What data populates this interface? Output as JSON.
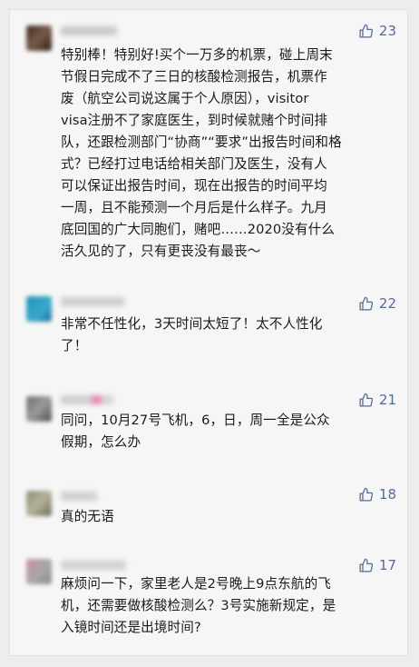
{
  "comments": [
    {
      "likes": "23",
      "text": "特别棒！特别好!买个一万多的机票，碰上周末\n节假日完成不了三日的核酸检测报告，机票作\n废（航空公司说这属于个人原因），visitor\nvisa注册不了家庭医生，到时候就赌个时间排\n队，还跟检测部门“协商”“要求”出报告时间和格\n式？已经打过电话给相关部门及医生，没有人\n可以保证出报告时间，现在出报告的时间平均\n一周，且不能预测一个月后是什么样子。九月\n底回国的广大同胞们，赌吧……2020没有什么\n活久见的了，只有更丧没有最丧～"
    },
    {
      "likes": "22",
      "text": "非常不任性化，3天时间太短了！太不人性化\n了！"
    },
    {
      "likes": "21",
      "text": "同问，10月27号飞机，6，日，周一全是公众\n假期，怎么办"
    },
    {
      "likes": "18",
      "text": "真的无语"
    },
    {
      "likes": "17",
      "text": "麻烦问一下，家里老人是2号晚上9点东航的飞\n机，还需要做核酸检测么？3号实施新规定，是\n入镜时间还是出境时间?"
    }
  ],
  "icons": {
    "like": "thumbs-up-icon"
  },
  "colors": {
    "like": "#576b95",
    "text": "#1a1a1a",
    "background": "#f6f6f6"
  }
}
